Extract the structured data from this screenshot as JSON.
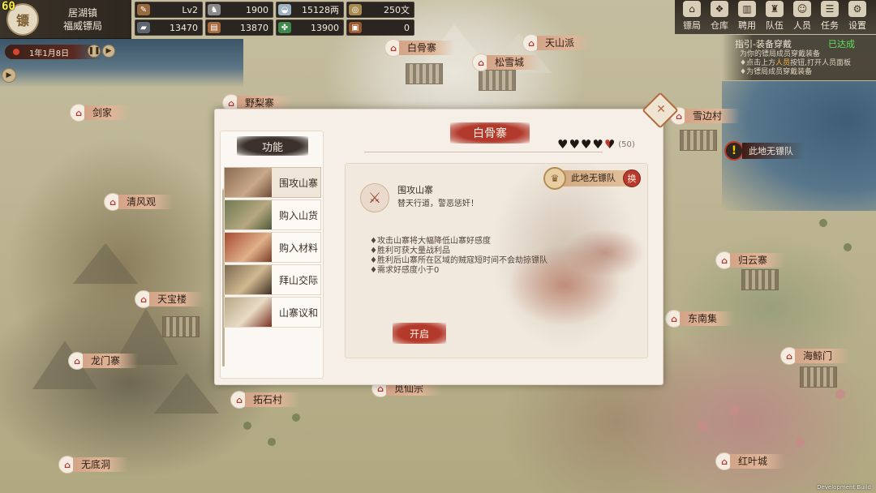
{
  "hud": {
    "fps": "60",
    "town": "居湖镇",
    "agency": "福威镖局",
    "emblem": "镖",
    "date": "1年1月8日",
    "resources": [
      {
        "icon": "scroll-icon",
        "glyph": "✎",
        "color": "#9a6a3c",
        "value": "Lv2"
      },
      {
        "icon": "horse-icon",
        "glyph": "♞",
        "color": "#8b8b8b",
        "value": "1900"
      },
      {
        "icon": "silver-ingot-icon",
        "glyph": "◒",
        "color": "#9fb3c0",
        "value": "15128两"
      },
      {
        "icon": "copper-coin-icon",
        "glyph": "◎",
        "color": "#a98a50",
        "value": "250文"
      },
      {
        "icon": "iron-icon",
        "glyph": "▰",
        "color": "#5d6770",
        "value": "13470"
      },
      {
        "icon": "wood-icon",
        "glyph": "▤",
        "color": "#a66a3f",
        "value": "13870"
      },
      {
        "icon": "herb-icon",
        "glyph": "✤",
        "color": "#3f8a4a",
        "value": "13900"
      },
      {
        "icon": "chest-icon",
        "glyph": "▣",
        "color": "#9c5b2f",
        "value": "0"
      }
    ]
  },
  "menu": [
    {
      "name": "menu-agency",
      "icon": "agency-icon",
      "glyph": "⌂",
      "label": "镖局"
    },
    {
      "name": "menu-warehouse",
      "icon": "warehouse-icon",
      "glyph": "❖",
      "label": "仓库"
    },
    {
      "name": "menu-hire",
      "icon": "hire-icon",
      "glyph": "▥",
      "label": "聘用"
    },
    {
      "name": "menu-team",
      "icon": "team-icon",
      "glyph": "♜",
      "label": "队伍"
    },
    {
      "name": "menu-people",
      "icon": "person-icon",
      "glyph": "☺",
      "label": "人员"
    },
    {
      "name": "menu-tasks",
      "icon": "task-icon",
      "glyph": "☰",
      "label": "任务"
    },
    {
      "name": "menu-settings",
      "icon": "gear-icon",
      "glyph": "⚙",
      "label": "设置"
    }
  ],
  "quest": {
    "title": "指引-装备穿戴",
    "status": "已达成",
    "line1": "为你的镖局成员穿戴装备",
    "line2_pre": "♦点击上方",
    "line2_hl": "人员",
    "line2_post": "按钮,打开人员面板",
    "line3": "♦为镖局成员穿戴装备"
  },
  "map": {
    "places": [
      "白骨寨",
      "天山派",
      "松雪城",
      "剑家",
      "野梨寨",
      "雪边村",
      "清风观",
      "归云寨",
      "天宝楼",
      "东南集",
      "龙门寨",
      "海鲸门",
      "拓石村",
      "觅仙宗",
      "无底洞",
      "红叶城"
    ],
    "bandit_alert": "此地无镖队",
    "dev_build": "Development Build"
  },
  "dialog": {
    "functions_title": "功能",
    "functions": [
      {
        "label": "围攻山寨",
        "active": true
      },
      {
        "label": "购入山货",
        "active": false
      },
      {
        "label": "购入材料",
        "active": false
      },
      {
        "label": "拜山交际",
        "active": false
      },
      {
        "label": "山寨议和",
        "active": false
      }
    ],
    "location": "白骨寨",
    "hearts_filled": 4.5,
    "hearts_total": 5,
    "favor": "(50)",
    "action_title": "围攻山寨",
    "action_desc": "替天行道，警恶惩奸！",
    "escort_label": "此地无镖队",
    "swap_label": "换",
    "bullets": [
      "♦攻击山寨将大幅降低山寨好感度",
      "♦胜利可获大量战利品",
      "♦胜利后山寨所在区域的贼寇短时间不会劫掠镖队",
      "♦需求好感度小于0"
    ],
    "start_label": "开启"
  }
}
